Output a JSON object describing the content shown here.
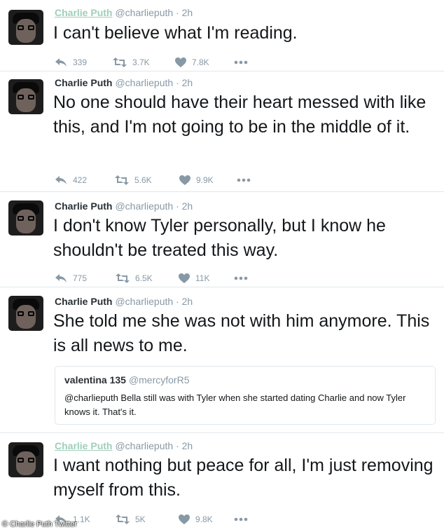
{
  "colors": {
    "name_link": "#9fcfb9",
    "action_grey": "#8899a6",
    "text": "#14171a"
  },
  "tweets": [
    {
      "name": "Charlie Puth",
      "handle": "@charlieputh",
      "time": "· 2h",
      "text": "I can't believe what I'm reading.",
      "replies": "339",
      "retweets": "3.7K",
      "likes": "7.8K"
    },
    {
      "name": "Charlie Puth",
      "handle": "@charlieputh",
      "time": "· 2h",
      "text": "No one should have their heart messed with like this, and I'm not going to be in the middle of it.",
      "replies": "422",
      "retweets": "5.6K",
      "likes": "9.9K"
    },
    {
      "name": "Charlie Puth",
      "handle": "@charlieputh",
      "time": "· 2h",
      "text": "I don't know Tyler personally, but I know he shouldn't be treated this way.",
      "replies": "775",
      "retweets": "6.5K",
      "likes": "11K"
    },
    {
      "name": "Charlie Puth",
      "handle": "@charlieputh",
      "time": "· 2h",
      "text": "She told me she was not with him anymore. This is all news to me.",
      "quote": {
        "name": "valentina 135",
        "handle": "@mercyforR5",
        "text": "@charlieputh Bella still was with Tyler when she started dating Charlie and now Tyler knows it. That's it."
      }
    },
    {
      "name": "Charlie Puth",
      "handle": "@charlieputh",
      "time": "· 2h",
      "text": "I want nothing but peace for all, I'm just removing myself from this.",
      "replies": "1.1K",
      "retweets": "5K",
      "likes": "9.8K"
    }
  ],
  "watermark": "© Charlie Puth Twitter"
}
